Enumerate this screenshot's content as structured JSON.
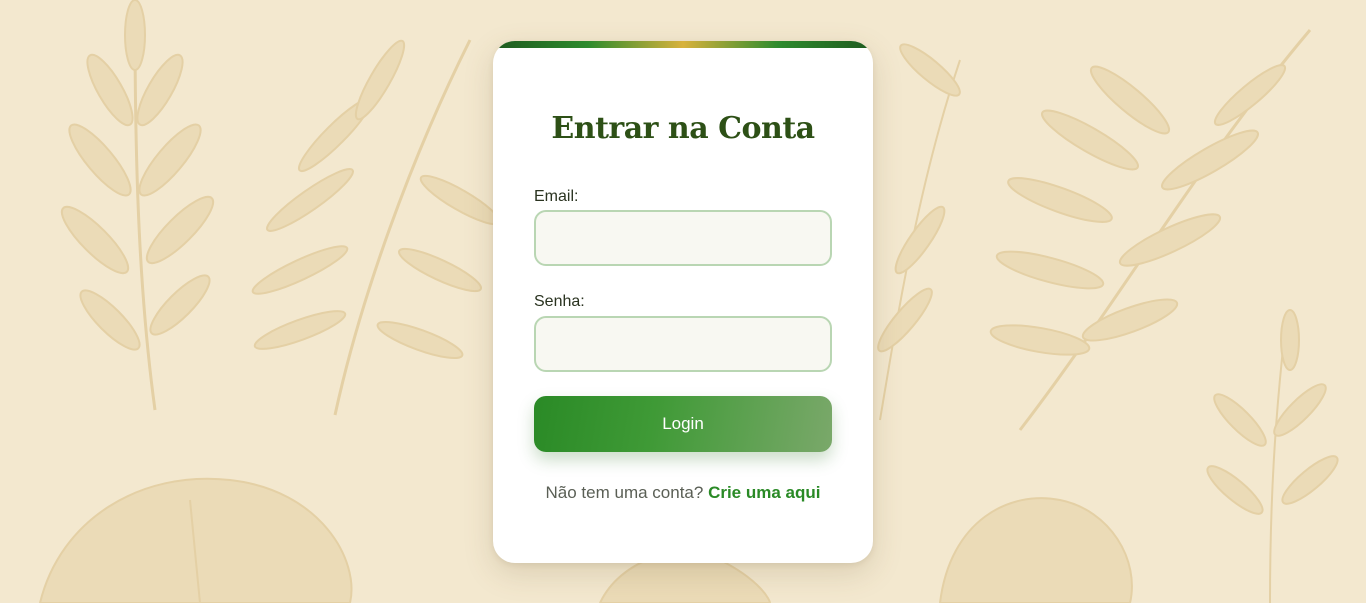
{
  "page": {
    "background_color": "#f3e8cf"
  },
  "login_card": {
    "title": "Entrar na Conta",
    "email": {
      "label": "Email:",
      "value": "",
      "placeholder": ""
    },
    "password": {
      "label": "Senha:",
      "value": "",
      "placeholder": ""
    },
    "login_button_label": "Login",
    "signup_prompt": "Não tem uma conta?",
    "signup_link_text": "Crie uma aqui",
    "colors": {
      "title": "#2d5016",
      "accent_green": "#2a8a26",
      "field_border": "#b9d6b3"
    }
  },
  "decorations": {
    "icons": [
      "fern-leaf-icon",
      "palm-frond-icon",
      "monstera-leaf-icon"
    ]
  }
}
